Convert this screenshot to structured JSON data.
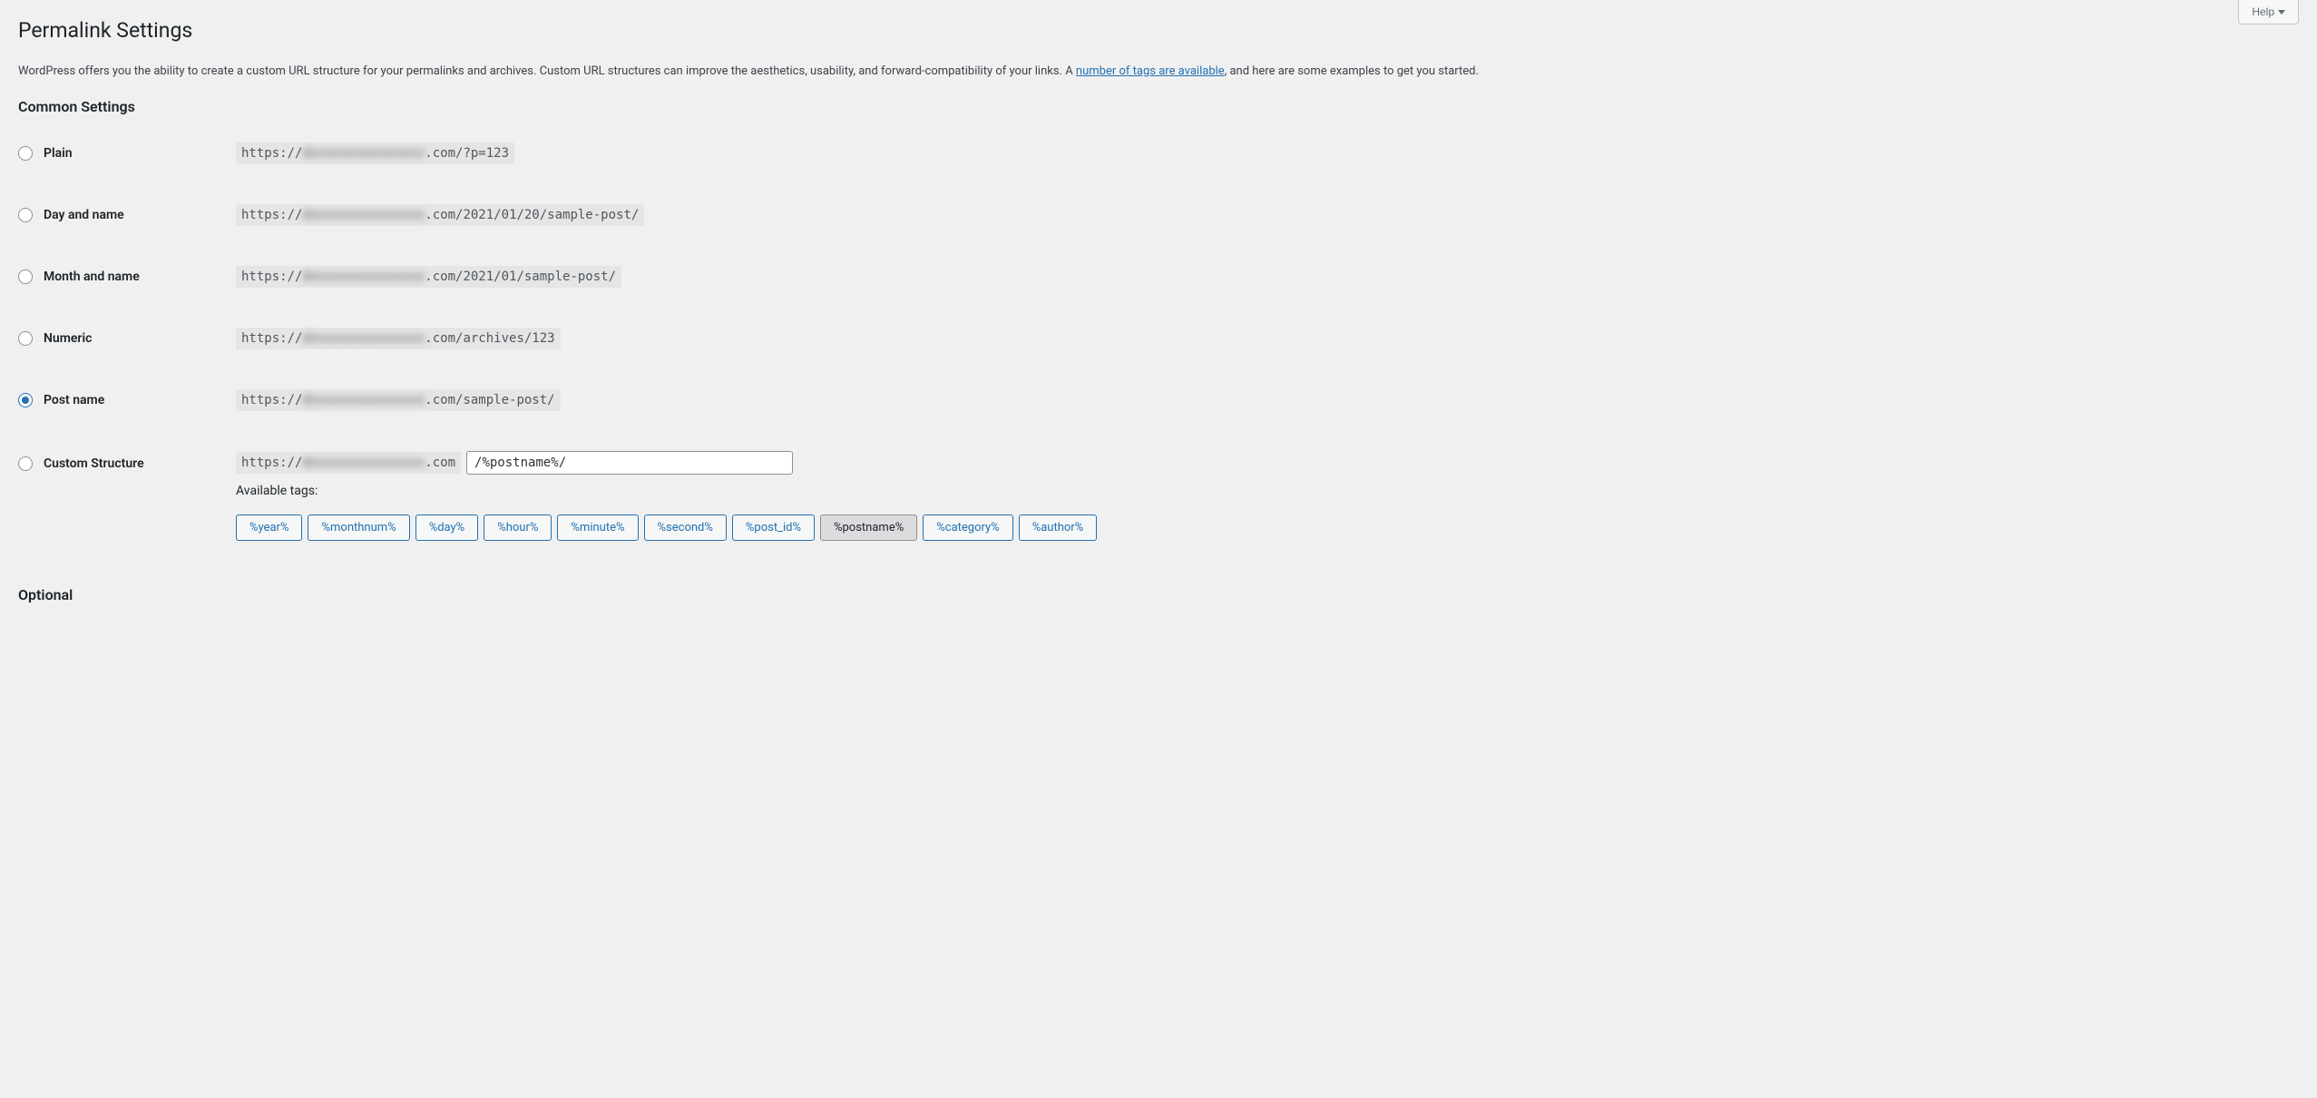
{
  "help_label": "Help",
  "page_title": "Permalink Settings",
  "intro_text_before": "WordPress offers you the ability to create a custom URL structure for your permalinks and archives. Custom URL structures can improve the aesthetics, usability, and forward-compatibility of your links. A ",
  "intro_link_text": "number of tags are available",
  "intro_text_after": ", and here are some examples to get you started.",
  "common_settings_heading": "Common Settings",
  "url_prefix": "https://",
  "url_domain_hidden": "dxxxxxxxxxxxxxxx",
  "url_tld": ".com",
  "options": {
    "plain": {
      "label": "Plain",
      "suffix": "/?p=123",
      "checked": false
    },
    "day_name": {
      "label": "Day and name",
      "suffix": "/2021/01/20/sample-post/",
      "checked": false
    },
    "month_name": {
      "label": "Month and name",
      "suffix": "/2021/01/sample-post/",
      "checked": false
    },
    "numeric": {
      "label": "Numeric",
      "suffix": "/archives/123",
      "checked": false
    },
    "post_name": {
      "label": "Post name",
      "suffix": "/sample-post/",
      "checked": true
    },
    "custom": {
      "label": "Custom Structure",
      "value": "/%postname%/",
      "checked": false
    }
  },
  "available_tags_label": "Available tags:",
  "tags": [
    {
      "label": "%year%",
      "active": false
    },
    {
      "label": "%monthnum%",
      "active": false
    },
    {
      "label": "%day%",
      "active": false
    },
    {
      "label": "%hour%",
      "active": false
    },
    {
      "label": "%minute%",
      "active": false
    },
    {
      "label": "%second%",
      "active": false
    },
    {
      "label": "%post_id%",
      "active": false
    },
    {
      "label": "%postname%",
      "active": true
    },
    {
      "label": "%category%",
      "active": false
    },
    {
      "label": "%author%",
      "active": false
    }
  ],
  "optional_heading": "Optional"
}
